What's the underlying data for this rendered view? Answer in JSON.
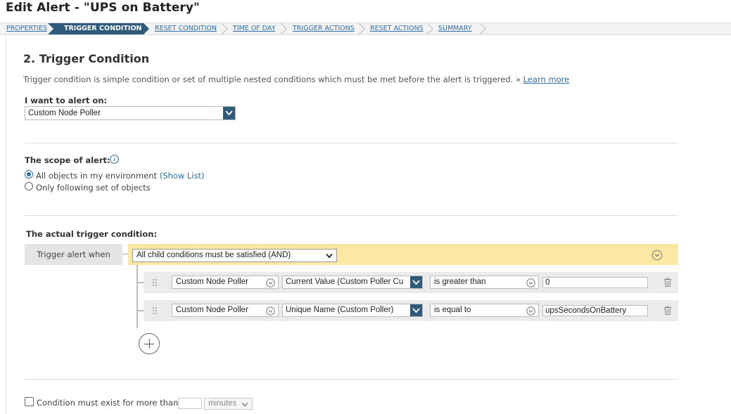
{
  "page": {
    "title": "Edit Alert - \"UPS on Battery\""
  },
  "steps": [
    {
      "label": "PROPERTIES",
      "active": false
    },
    {
      "label": "TRIGGER CONDITION",
      "active": true
    },
    {
      "label": "RESET CONDITION",
      "active": false
    },
    {
      "label": "TIME OF DAY",
      "active": false
    },
    {
      "label": "TRIGGER ACTIONS",
      "active": false
    },
    {
      "label": "RESET ACTIONS",
      "active": false
    },
    {
      "label": "SUMMARY",
      "active": false
    }
  ],
  "section": {
    "title": "2. Trigger Condition",
    "description": "Trigger condition is simple condition or set of multiple nested conditions which must be met before the alert is triggered.",
    "learn_prefix": "»",
    "learn_more": "Learn more"
  },
  "alert_on": {
    "label": "I want to alert on:",
    "value": "Custom Node Poller"
  },
  "scope": {
    "label": "The scope of alert:",
    "info_icon": "info-icon",
    "options": [
      {
        "label": "All objects in my environment",
        "link": "(Show List)",
        "selected": true
      },
      {
        "label": "Only following set of objects",
        "selected": false
      }
    ]
  },
  "trigger": {
    "label": "The actual trigger condition:",
    "when_label": "Trigger alert when",
    "logic_value": "All child conditions must be satisfied (AND)",
    "conditions": [
      {
        "object": "Custom Node Poller",
        "field": "Current Value (Custom Poller Cu",
        "operator": "is greater than",
        "value": "0"
      },
      {
        "object": "Custom Node Poller",
        "field": "Unique Name (Custom Poller)",
        "operator": "is equal to",
        "value": "upsSecondsOnBattery"
      }
    ]
  },
  "duration": {
    "checked": false,
    "label": "Condition must exist for more than",
    "amount": "",
    "unit": "minutes"
  },
  "colors": {
    "accent": "#2f5b7b",
    "link": "#2f6fa8",
    "highlight": "#fbe9a3"
  }
}
